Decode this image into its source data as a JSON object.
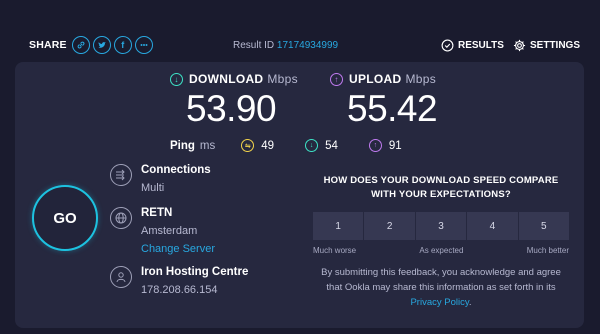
{
  "header": {
    "share_label": "SHARE",
    "share_icons": [
      "link-icon",
      "twitter-icon",
      "facebook-icon",
      "more-icon"
    ],
    "result_label": "Result ID",
    "result_id": "17174934999",
    "results_label": "RESULTS",
    "settings_label": "SETTINGS"
  },
  "download": {
    "label": "DOWNLOAD",
    "unit": "Mbps",
    "value": "53.90"
  },
  "upload": {
    "label": "UPLOAD",
    "unit": "Mbps",
    "value": "55.42"
  },
  "ping": {
    "label": "Ping",
    "unit": "ms",
    "idle": "49",
    "download": "54",
    "upload": "91"
  },
  "go_label": "GO",
  "connections": {
    "title": "Connections",
    "value": "Multi"
  },
  "server": {
    "title": "RETN",
    "location": "Amsterdam",
    "change_label": "Change Server"
  },
  "host": {
    "title": "Iron Hosting Centre",
    "ip": "178.208.66.154"
  },
  "survey": {
    "question": "HOW DOES YOUR DOWNLOAD SPEED COMPARE WITH YOUR EXPECTATIONS?",
    "options": [
      "1",
      "2",
      "3",
      "4",
      "5"
    ],
    "low_label": "Much worse",
    "mid_label": "As expected",
    "high_label": "Much better",
    "note": "By submitting this feedback, you acknowledge and agree that Ookla may share this information as set forth in its",
    "privacy_label": "Privacy Policy",
    "note_end": "."
  },
  "colors": {
    "accent": "#28a8e0",
    "download": "#3de3c6",
    "upload": "#c07bf0",
    "idle": "#f3d44b",
    "background": "#1a1b2e",
    "panel": "#26283f"
  }
}
